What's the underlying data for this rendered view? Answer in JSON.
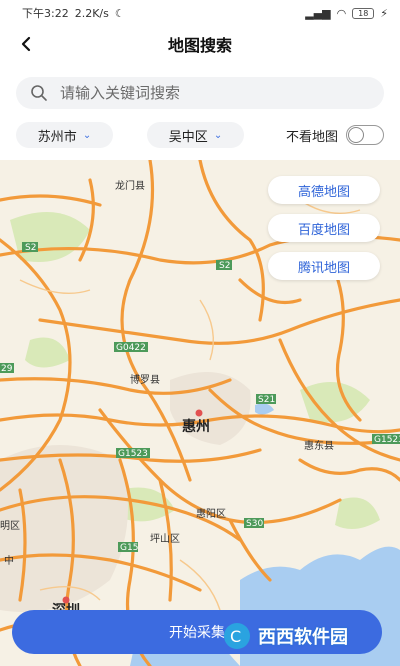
{
  "status": {
    "time": "下午3:22",
    "speed": "2.2K/s",
    "battery": "18"
  },
  "header": {
    "title": "地图搜索"
  },
  "search": {
    "placeholder": "请输入关键词搜索"
  },
  "filters": {
    "city": "苏州市",
    "district": "吴中区",
    "toggle_label": "不看地图",
    "toggle_on": false
  },
  "map": {
    "providers": [
      "高德地图",
      "百度地图",
      "腾讯地图"
    ],
    "places": {
      "longmen": "龙门县",
      "boluo": "博罗县",
      "huizhou": "惠州",
      "huidong": "惠东县",
      "huiyang": "惠阳区",
      "pingshan": "坪山区",
      "shenzhen": "深圳",
      "mingqu": "明区",
      "zhong": "中"
    },
    "roads": {
      "s2a": "S2",
      "s2b": "S2",
      "g0422": "G0422",
      "s21": "S21",
      "g1523a": "G1523",
      "g1523b": "G1523",
      "s30": "S30",
      "g15": "G15",
      "r29": "29"
    },
    "colors": {
      "land": "#f6f1e5",
      "water": "#a9cdf1",
      "green": "#cfe3a8",
      "road": "#f29a3a"
    }
  },
  "footer": {
    "start_label": "开始采集",
    "watermark": "西西软件园"
  }
}
